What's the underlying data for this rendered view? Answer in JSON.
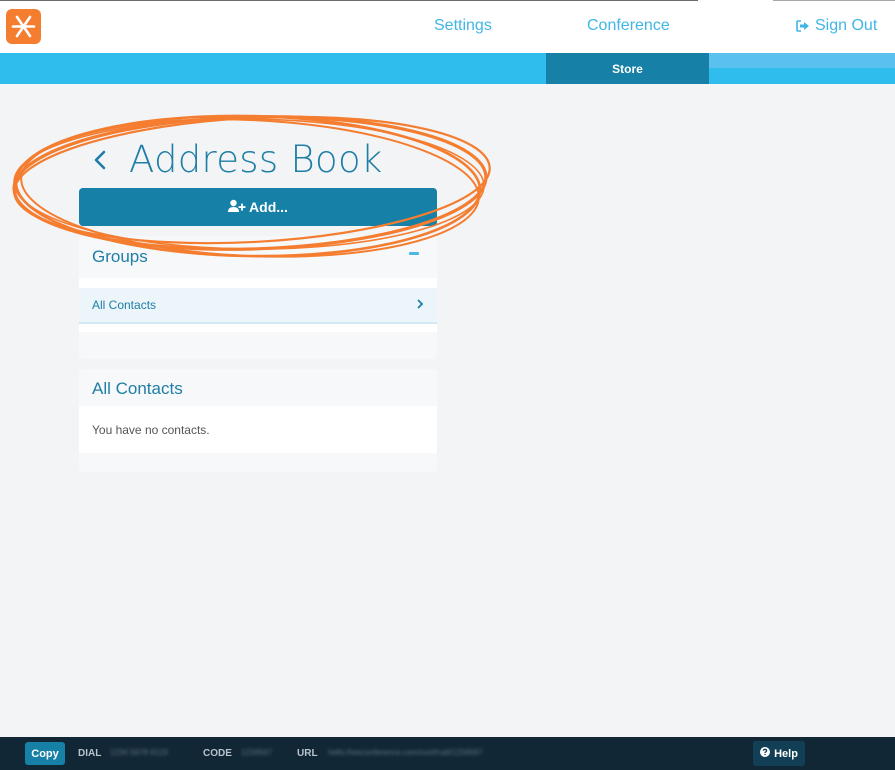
{
  "header": {
    "logo_icon": "asterisk-logo-icon",
    "nav": {
      "settings": "Settings",
      "conference": "Conference",
      "sign_out": "Sign Out",
      "sign_out_icon": "sign-out-icon"
    },
    "subnav": {
      "store": "Store"
    }
  },
  "colors": {
    "brand_orange": "#f47d30",
    "primary_blue": "#1680a7",
    "accent_blue": "#2ebdec",
    "link_blue": "#3fb6e6",
    "footer_bg": "#122736"
  },
  "page": {
    "title": "Address Book",
    "back_icon": "chevron-left-icon",
    "add_button": {
      "label": "Add...",
      "icon": "add-user-icon"
    },
    "groups": {
      "heading": "Groups",
      "items": [
        {
          "label": "All Contacts",
          "icon": "chevron-right-icon"
        }
      ]
    },
    "contacts": {
      "heading": "All Contacts",
      "empty_message": "You have no contacts."
    }
  },
  "footer": {
    "copy_label": "Copy",
    "dial_label": "DIAL",
    "dial_value": "1234 5678 9123",
    "code_label": "CODE",
    "code_value": "1234567",
    "url_label": "URL",
    "url_value": "hello.freeconference.com/conf/call/1234567",
    "help_label": "Help",
    "help_icon": "question-circle-icon"
  }
}
